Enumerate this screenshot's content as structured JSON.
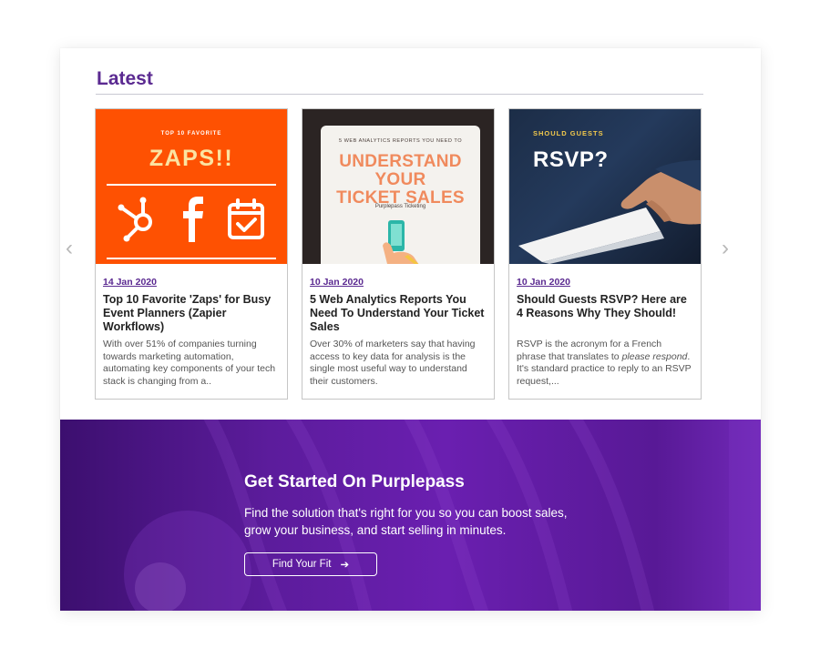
{
  "section": {
    "title": "Latest"
  },
  "carousel": {
    "prev_icon": "chevron-left-icon",
    "next_icon": "chevron-right-icon",
    "prev_glyph": "‹",
    "next_glyph": "›"
  },
  "cards": [
    {
      "date": "14 Jan 2020",
      "title": "Top 10 Favorite 'Zaps' for Busy Event Planners (Zapier Workflows)",
      "excerpt": "With over 51% of companies turning towards marketing automation, automating key components of your tech stack is changing from a..",
      "image": {
        "kicker": "TOP 10 FAVORITE",
        "headline": "ZAPS!!",
        "icons": [
          "hubspot-icon",
          "facebook-icon",
          "calendar-check-icon"
        ],
        "bg": "#fe5102",
        "headline_color": "#fbe3a1"
      }
    },
    {
      "date": "10 Jan 2020",
      "title": "5 Web Analytics Reports You Need To Understand Your Ticket Sales",
      "excerpt": "Over 30% of marketers say that having access to key data for analysis is the single most useful way to understand their customers.",
      "image": {
        "kicker": "5 WEB ANALYTICS REPORTS YOU NEED TO",
        "headline_line1": "UNDERSTAND YOUR",
        "headline_line2": "TICKET SALES",
        "sub": "Purplepass Ticketing",
        "icons": [
          "phone-in-hand-icon"
        ],
        "headline_color": "#f08a5d"
      }
    },
    {
      "date": "10 Jan 2020",
      "title": "Should Guests RSVP? Here are 4 Reasons Why They Should!",
      "excerpt_before": "RSVP is the acronym for a French phrase that translates to ",
      "excerpt_em": "please respond",
      "excerpt_after": ". It's standard practice to reply to an RSVP request,...",
      "image": {
        "kicker": "SHOULD GUESTS",
        "headline": "RSVP?",
        "icons": [
          "hand-with-envelope-icon"
        ],
        "kicker_color": "#f2c94c"
      }
    }
  ],
  "banner": {
    "title": "Get Started On Purplepass",
    "text": "Find the solution that's right for you so you can boost sales, grow your business, and start selling in minutes.",
    "button_label": "Find Your Fit",
    "button_icon": "arrow-right-icon",
    "button_glyph": "➔"
  },
  "colors": {
    "accent": "#5b2a91",
    "banner_purple": "#6a1fb0"
  }
}
